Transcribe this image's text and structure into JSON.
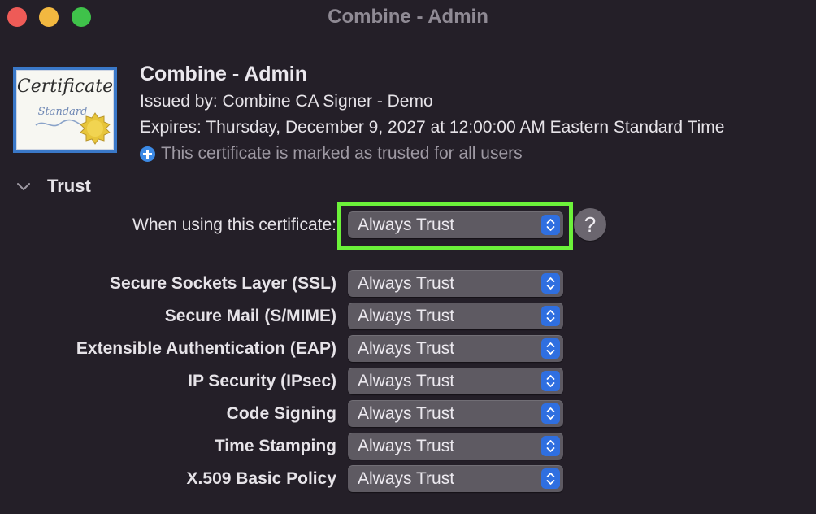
{
  "window": {
    "title": "Combine - Admin"
  },
  "certificate": {
    "icon": "certificate-icon",
    "icon_text": "Certificate",
    "icon_subtext": "Standard",
    "name": "Combine - Admin",
    "issued_by": "Issued by: Combine CA Signer - Demo",
    "expires": "Expires: Thursday, December 9, 2027 at 12:00:00 AM Eastern Standard Time",
    "trusted_note": "This certificate is marked as trusted for all users"
  },
  "trust": {
    "section_title": "Trust",
    "main_label": "When using this certificate:",
    "main_value": "Always Trust",
    "help_label": "?",
    "highlight_color": "#6cf23a",
    "policies": [
      {
        "label": "Secure Sockets Layer (SSL)",
        "value": "Always Trust"
      },
      {
        "label": "Secure Mail (S/MIME)",
        "value": "Always Trust"
      },
      {
        "label": "Extensible Authentication (EAP)",
        "value": "Always Trust"
      },
      {
        "label": "IP Security (IPsec)",
        "value": "Always Trust"
      },
      {
        "label": "Code Signing",
        "value": "Always Trust"
      },
      {
        "label": "Time Stamping",
        "value": "Always Trust"
      },
      {
        "label": "X.509 Basic Policy",
        "value": "Always Trust"
      }
    ]
  },
  "colors": {
    "background": "#241f28",
    "accent": "#2f6fe0",
    "close": "#ee5b57",
    "minimize": "#f2b840",
    "zoom": "#3fc24a"
  }
}
